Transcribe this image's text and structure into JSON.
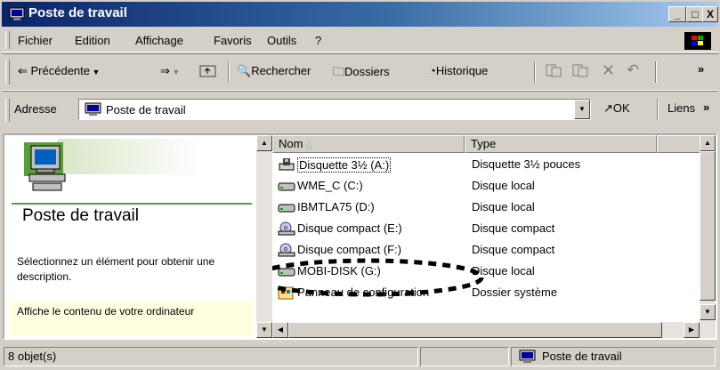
{
  "window": {
    "title": "Poste de travail",
    "buttons": {
      "minimize": "_",
      "maximize": "□",
      "close": "X"
    }
  },
  "menubar": {
    "items": [
      {
        "label": "Fichier"
      },
      {
        "label": "Edition"
      },
      {
        "label": "Affichage"
      },
      {
        "label": "Favoris"
      },
      {
        "label": "Outils"
      },
      {
        "label": "?"
      }
    ]
  },
  "toolbar": {
    "back": "Précédente",
    "forward_arrow": "⇒",
    "search": "Rechercher",
    "folders": "Dossiers",
    "history": "Historique",
    "more": "»"
  },
  "address": {
    "label": "Adresse",
    "value": "Poste de travail",
    "go": "OK",
    "links": "Liens"
  },
  "leftpanel": {
    "title": "Poste de travail",
    "description": "Sélectionnez un élément pour obtenir une description.",
    "info": "Affiche le contenu de votre ordinateur"
  },
  "listview": {
    "columns": [
      {
        "label": "Nom"
      },
      {
        "label": "Type"
      }
    ],
    "rows": [
      {
        "name": "Disquette 3½ (A:)",
        "type": "Disquette 3½ pouces",
        "icon": "floppy-drive-icon"
      },
      {
        "name": "WME_C (C:)",
        "type": "Disque local",
        "icon": "hard-drive-icon"
      },
      {
        "name": "IBMTLA75 (D:)",
        "type": "Disque local",
        "icon": "hard-drive-icon"
      },
      {
        "name": "Disque compact (E:)",
        "type": "Disque compact",
        "icon": "cd-drive-icon"
      },
      {
        "name": "Disque compact (F:)",
        "type": "Disque compact",
        "icon": "cd-drive-icon"
      },
      {
        "name": "MOBI-DISK (G:)",
        "type": "Disque local",
        "icon": "hard-drive-icon"
      },
      {
        "name": "Panneau de configuration",
        "type": "Dossier système",
        "icon": "control-panel-icon"
      }
    ]
  },
  "statusbar": {
    "count": "8 objet(s)",
    "location": "Poste de travail"
  },
  "colors": {
    "title_start": "#0a246a",
    "title_end": "#a6caf0",
    "face": "#d4d0c8"
  }
}
